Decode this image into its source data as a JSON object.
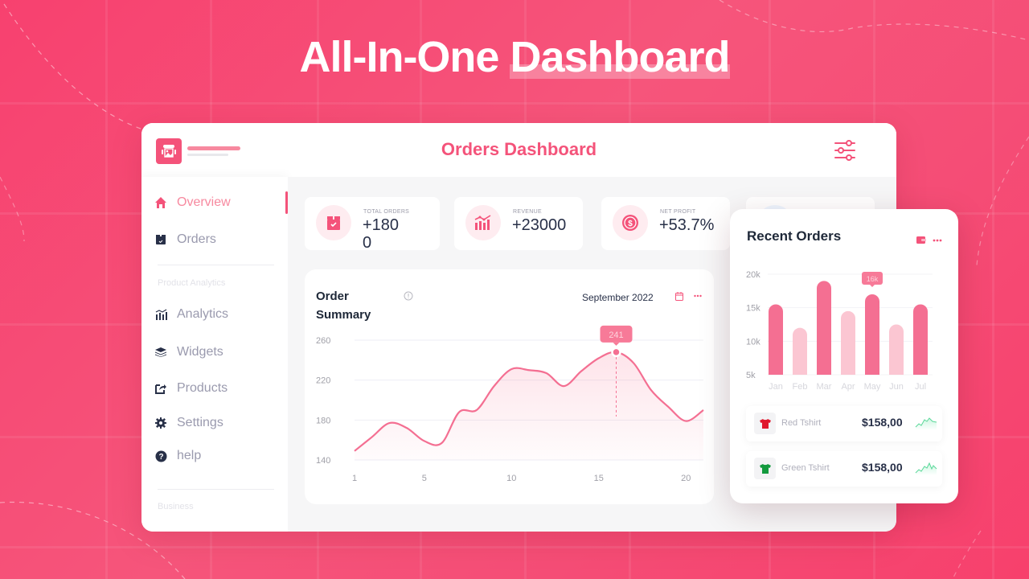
{
  "hero": {
    "title_part1": "All-In-One",
    "title_part2": "Dashboard"
  },
  "colors": {
    "accent": "#f4537a",
    "accent_light": "#fbc6d2",
    "bar_dark": "#f46f92",
    "spark": "#6ee7a8"
  },
  "topbar": {
    "title": "Orders Dashboard"
  },
  "sidebar": {
    "items": [
      {
        "label": "Overview",
        "icon": "home-icon",
        "active": true
      },
      {
        "label": "Orders",
        "icon": "box-icon"
      },
      {
        "label": "Analytics",
        "icon": "analytics-icon"
      },
      {
        "label": "Widgets",
        "icon": "layers-icon"
      },
      {
        "label": "Products",
        "icon": "share-icon"
      },
      {
        "label": "Settings",
        "icon": "gear-icon"
      },
      {
        "label": "help",
        "icon": "help-icon"
      }
    ],
    "sections": {
      "product": "Product Analytics",
      "business": "Business"
    }
  },
  "stats": [
    {
      "label": "TOTAL ORDERS",
      "value_line1": "+180",
      "value_line2": "0",
      "icon": "box-check-icon"
    },
    {
      "label": "REVENUE",
      "value_line1": "+23000",
      "icon": "chart-bars-icon"
    },
    {
      "label": "NET PROFIT",
      "value_line1": "+53.7%",
      "icon": "dollar-icon"
    }
  ],
  "order_summary": {
    "title": "Order Summary",
    "date": "September 2022",
    "tooltip": "241"
  },
  "recent_orders": {
    "title": "Recent Orders",
    "tooltip": "16k",
    "orders": [
      {
        "name": "Red Tshirt",
        "price": "$158,00",
        "color": "#e0182d"
      },
      {
        "name": "Green Tshirt",
        "price": "$158,00",
        "color": "#139a3e"
      }
    ]
  },
  "chart_data": [
    {
      "type": "area",
      "title": "Order Summary",
      "xlabel": "",
      "ylabel": "",
      "x": [
        1,
        2,
        3,
        4,
        5,
        6,
        7,
        8,
        9,
        10,
        11,
        12,
        13,
        14,
        15,
        16,
        17,
        18,
        19,
        20,
        21
      ],
      "values": [
        149,
        163,
        177,
        172,
        159,
        157,
        188,
        190,
        214,
        231,
        230,
        227,
        214,
        229,
        242,
        248,
        237,
        210,
        193,
        179,
        190
      ],
      "x_ticks": [
        1,
        5,
        10,
        15,
        20
      ],
      "y_ticks": [
        140,
        180,
        220,
        260
      ],
      "ylim": [
        140,
        260
      ],
      "xlim": [
        1,
        21
      ],
      "grid": true,
      "annotation": {
        "x": 16,
        "label": "241"
      }
    },
    {
      "type": "bar",
      "title": "Recent Orders",
      "categories": [
        "Jan",
        "Feb",
        "Mar",
        "Apr",
        "May",
        "Jun",
        "Jul"
      ],
      "values": [
        15.5,
        12,
        19,
        14.5,
        17,
        12.5,
        15.5
      ],
      "highlight": [
        true,
        false,
        true,
        false,
        true,
        false,
        true
      ],
      "y_ticks": [
        "5k",
        "10k",
        "15k",
        "20k"
      ],
      "ylim": [
        5,
        20
      ],
      "unit": "k",
      "grid": true,
      "annotation": {
        "category": "May",
        "label": "16k"
      }
    }
  ]
}
